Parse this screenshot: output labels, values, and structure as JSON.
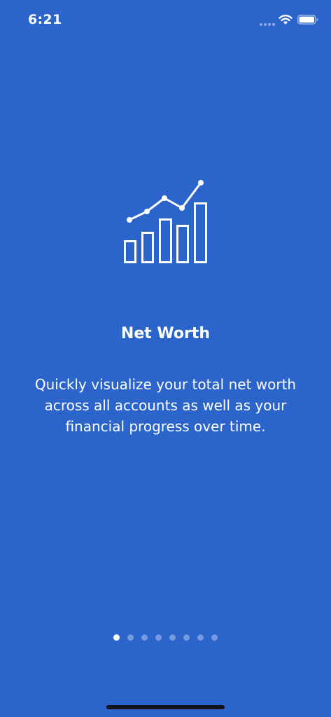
{
  "status_bar": {
    "time": "6:21",
    "icons": [
      "signal-dots-icon",
      "wifi-icon",
      "battery-icon"
    ]
  },
  "onboarding": {
    "icon": "net-worth-chart-icon",
    "title": "Net Worth",
    "description": "Quickly visualize your total net worth across all accounts as well as your financial progress over time."
  },
  "pager": {
    "page_count": 8,
    "current_page": 1
  },
  "colors": {
    "background": "#2B65CC",
    "text": "#FFFFFF",
    "home_indicator": "#111418"
  }
}
